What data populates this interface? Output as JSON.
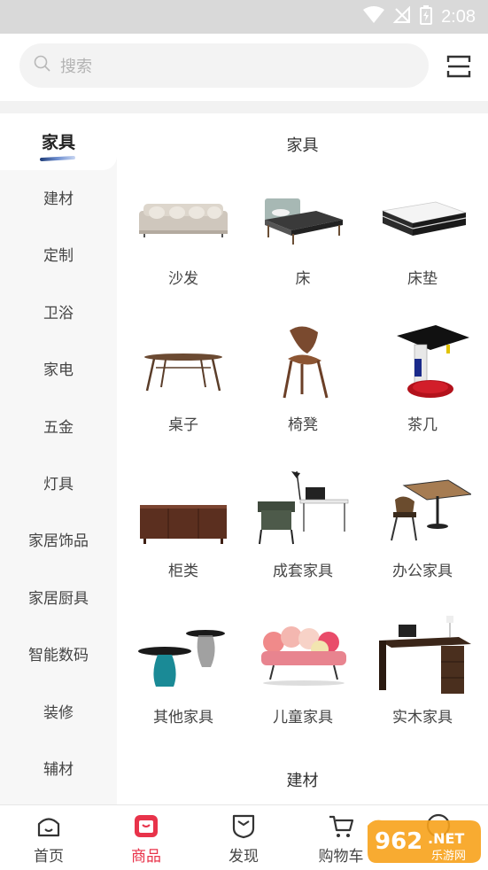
{
  "status_bar": {
    "time": "2:08"
  },
  "search": {
    "placeholder": "搜索"
  },
  "sidebar": {
    "active": "家具",
    "items": [
      "建材",
      "定制",
      "卫浴",
      "家电",
      "五金",
      "灯具",
      "家居饰品",
      "家居厨具",
      "智能数码",
      "装修",
      "辅材"
    ]
  },
  "main": {
    "section_title": "家具",
    "next_section_title": "建材",
    "tiles": [
      {
        "label": "沙发",
        "icon": "sofa-icon"
      },
      {
        "label": "床",
        "icon": "bed-icon"
      },
      {
        "label": "床垫",
        "icon": "mattress-icon"
      },
      {
        "label": "桌子",
        "icon": "table-icon"
      },
      {
        "label": "椅凳",
        "icon": "chair-icon"
      },
      {
        "label": "茶几",
        "icon": "coffee-table-icon"
      },
      {
        "label": "柜类",
        "icon": "cabinet-icon"
      },
      {
        "label": "成套家具",
        "icon": "furniture-set-icon"
      },
      {
        "label": "办公家具",
        "icon": "office-furniture-icon"
      },
      {
        "label": "其他家具",
        "icon": "side-tables-icon"
      },
      {
        "label": "儿童家具",
        "icon": "kids-sofa-icon"
      },
      {
        "label": "实木家具",
        "icon": "wood-desk-icon"
      }
    ]
  },
  "tabbar": {
    "items": [
      {
        "label": "首页",
        "icon": "home-icon"
      },
      {
        "label": "商品",
        "icon": "goods-icon"
      },
      {
        "label": "发现",
        "icon": "discover-icon"
      },
      {
        "label": "购物车",
        "icon": "cart-icon"
      },
      {
        "label": "",
        "icon": "profile-icon"
      }
    ]
  },
  "watermark": {
    "number": "962",
    "suffix": ".NET",
    "site": "乐游网"
  },
  "colors": {
    "accent": "#e8334a",
    "sidebar_bg": "#f7f7f7",
    "status_bar": "#d9d9d9"
  }
}
